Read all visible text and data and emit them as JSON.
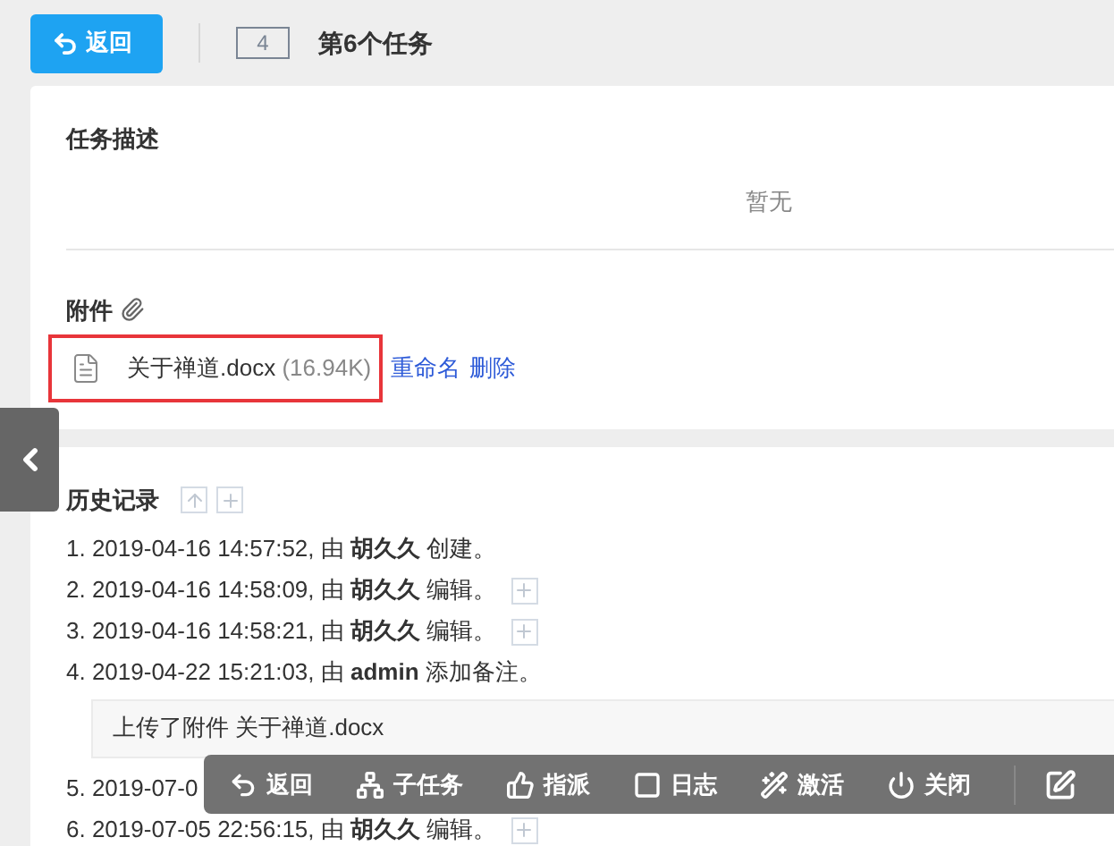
{
  "header": {
    "back_label": "返回",
    "task_id": "4",
    "task_title": "第6个任务"
  },
  "description": {
    "title": "任务描述",
    "empty_text": "暂无"
  },
  "attachments": {
    "title": "附件",
    "files": [
      {
        "name": "关于禅道.docx",
        "size": "(16.94K)",
        "actions": [
          "重命名",
          "删除"
        ]
      }
    ]
  },
  "history": {
    "title": "历史记录",
    "entries": [
      {
        "prefix": "1. 2019-04-16 14:57:52, 由 ",
        "actor": "胡久久",
        "action": " 创建。",
        "expand": false
      },
      {
        "prefix": "2. 2019-04-16 14:58:09, 由 ",
        "actor": "胡久久",
        "action": " 编辑。",
        "expand": true
      },
      {
        "prefix": "3. 2019-04-16 14:58:21, 由 ",
        "actor": "胡久久",
        "action": " 编辑。",
        "expand": true
      },
      {
        "prefix": "4. 2019-04-22 15:21:03, 由 ",
        "actor": "admin",
        "action": " 添加备注。",
        "expand": false,
        "note": "上传了附件 关于禅道.docx"
      },
      {
        "prefix": "5. 2019-07-0",
        "expand": false
      },
      {
        "prefix": "6. 2019-07-05 22:56:15, 由 ",
        "actor": "胡久久",
        "action": " 编辑。",
        "expand": true
      }
    ]
  },
  "toolbar": [
    {
      "kind": "back",
      "label": "返回"
    },
    {
      "kind": "subtask",
      "label": "子任务"
    },
    {
      "kind": "assign",
      "label": "指派"
    },
    {
      "kind": "log",
      "label": "日志"
    },
    {
      "kind": "activate",
      "label": "激活"
    },
    {
      "kind": "close",
      "label": "关闭"
    },
    {
      "kind": "edit"
    }
  ]
}
